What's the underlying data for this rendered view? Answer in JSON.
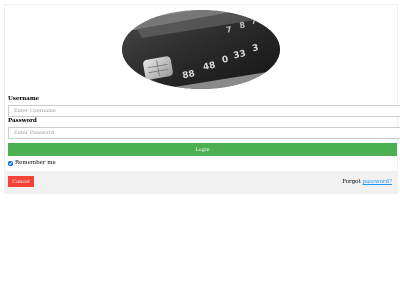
{
  "avatar": {
    "icon": "credit-card-image"
  },
  "form": {
    "username_label": "Username",
    "username_placeholder": "Enter Username",
    "password_label": "Password",
    "password_placeholder": "Enter Password",
    "login_label": "Login",
    "remember_label": "Remember me",
    "remember_checked": true
  },
  "footer": {
    "cancel_label": "Cancel",
    "forgot_prefix": "Forgot",
    "forgot_link": "password?"
  },
  "colors": {
    "login": "#4caf50",
    "cancel": "#f44336",
    "link": "#2196f3",
    "footer_bg": "#f1f1f1"
  }
}
